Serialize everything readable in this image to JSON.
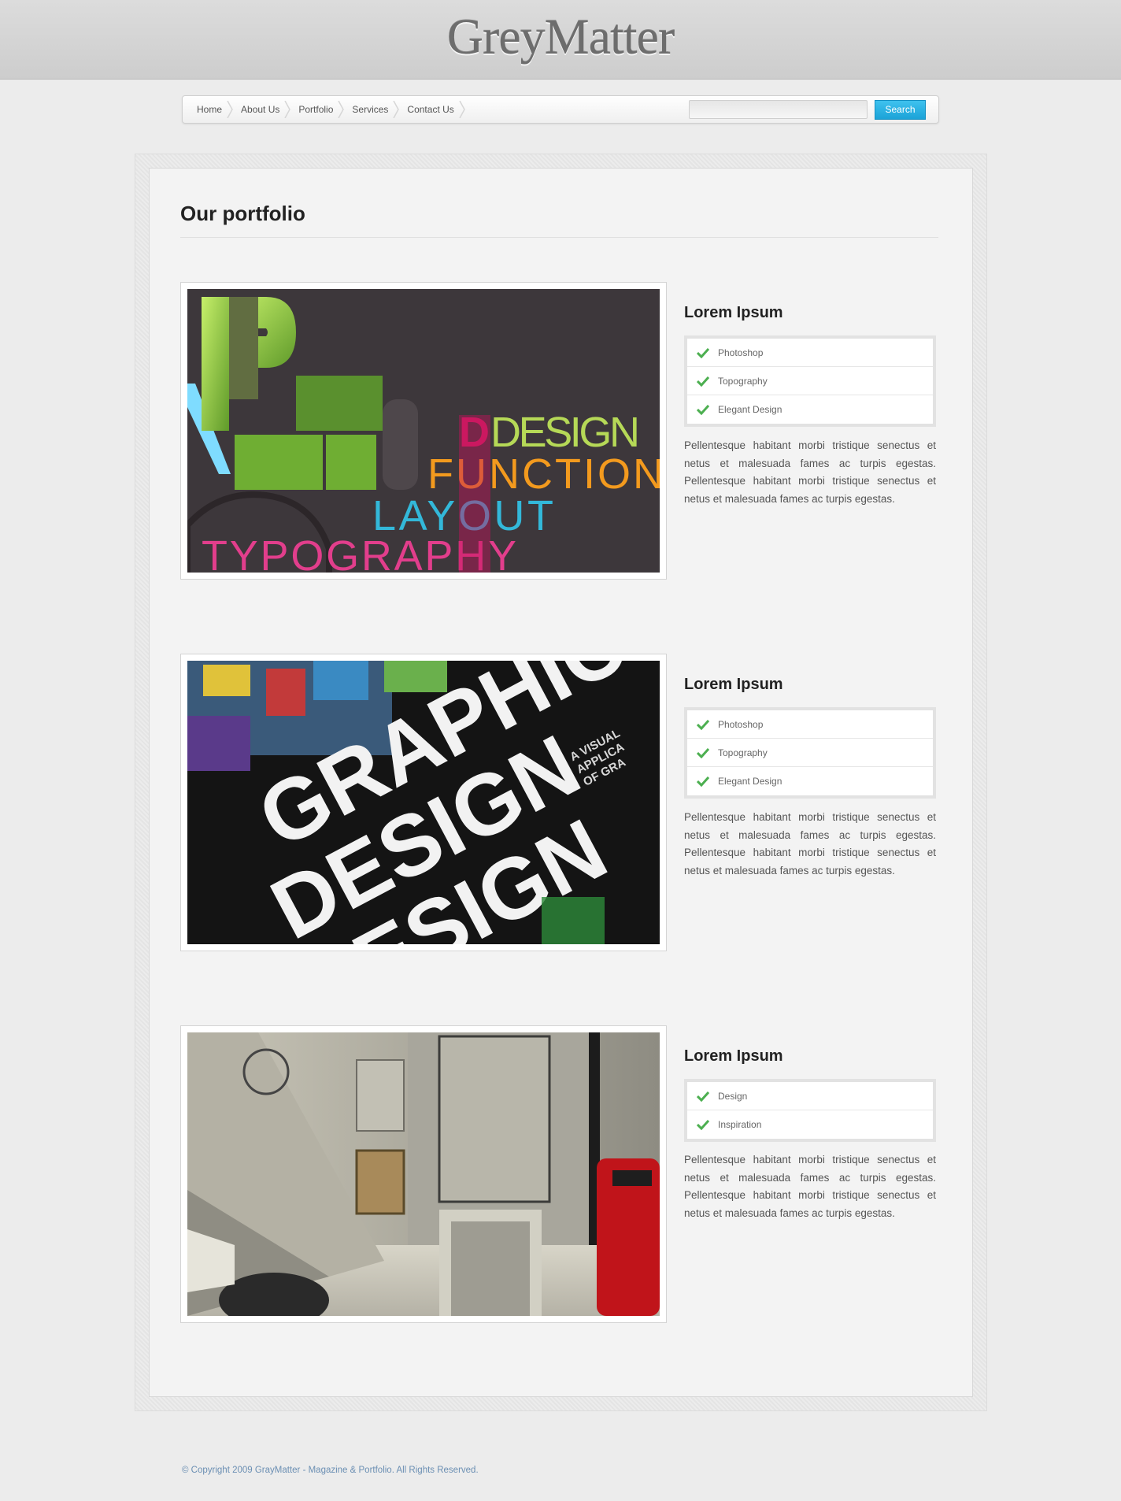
{
  "site": {
    "logo": "GreyMatter"
  },
  "nav": {
    "items": [
      "Home",
      "About Us",
      "Portfolio",
      "Services",
      "Contact Us"
    ],
    "search_placeholder": "",
    "search_button": "Search"
  },
  "page": {
    "title": "Our portfolio"
  },
  "portfolio": [
    {
      "title": "Lorem Ipsum",
      "tags": [
        "Photoshop",
        "Topography",
        "Elegant Design"
      ],
      "description": "Pellentesque habitant morbi tristique senectus et netus et malesuada fames ac turpis egestas. Pellentesque habitant morbi tristique senectus et netus et malesuada fames ac turpis egestas.",
      "image_words": [
        "DESIGN",
        "FUNCTION",
        "LAYOUT",
        "TYPOGRAPHY"
      ]
    },
    {
      "title": "Lorem Ipsum",
      "tags": [
        "Photoshop",
        "Topography",
        "Elegant Design"
      ],
      "description": "Pellentesque habitant morbi tristique senectus et netus et malesuada fames ac turpis egestas. Pellentesque habitant morbi tristique senectus et netus et malesuada fames ac turpis egestas.",
      "image_words": [
        "GRAPHIC",
        "DESIGN",
        "A VISUAL",
        "APPLICA",
        "OF GRA"
      ]
    },
    {
      "title": "Lorem Ipsum",
      "tags": [
        "Design",
        "Inspiration"
      ],
      "description": "Pellentesque habitant morbi tristique senectus et netus et malesuada fames ac turpis egestas. Pellentesque habitant morbi tristique senectus et netus et malesuada fames ac turpis egestas."
    }
  ],
  "footer": {
    "copyright": "© Copyright 2009 GrayMatter - Magazine & Portfolio. All Rights Reserved."
  },
  "colors": {
    "accent": "#1ba3d8",
    "check": "#4caf50",
    "footer_text": "#6b8fb3"
  }
}
